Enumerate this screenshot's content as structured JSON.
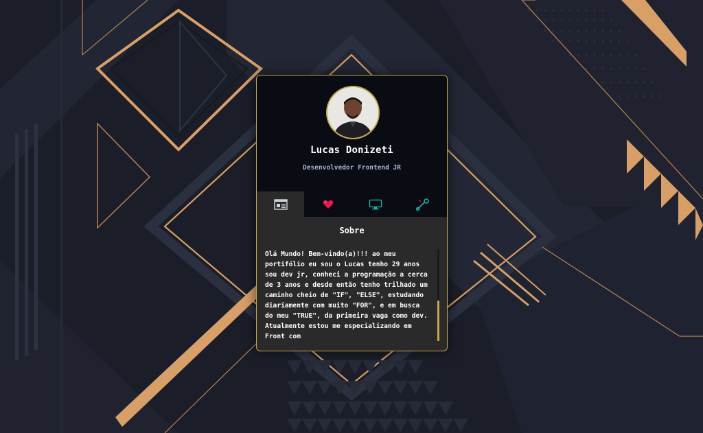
{
  "profile": {
    "name": "Lucas Donizeti",
    "role": "Desenvolvedor Frontend JR"
  },
  "tabs": [
    {
      "icon": "document-icon",
      "active": true
    },
    {
      "icon": "heart-icon",
      "active": false
    },
    {
      "icon": "monitor-icon",
      "active": false
    },
    {
      "icon": "wrench-icon",
      "active": false
    }
  ],
  "about": {
    "title": "Sobre",
    "text": "Olá Mundo! Bem-vindo(a)!!! ao meu portifólio eu sou o Lucas tenho 29 anos sou dev jr, conheci a programação a cerca de 3 anos e desde então tenho trilhado um caminho cheio de \"IF\", \"ELSE\", estudando diariamente com muito \"FOR\", e em busca do meu \"TRUE\", da primeira vaga como dev. Atualmente estou me especializando em Front com",
    "scroll_position": 0.56
  },
  "colors": {
    "accent": "#c8a74a",
    "copper": "#d8a067",
    "card_dark": "#090c12",
    "card_body": "#2a2a2a",
    "role_text": "#a9b0d3",
    "heart": "#e8194f",
    "teal": "#1fb8b0"
  }
}
